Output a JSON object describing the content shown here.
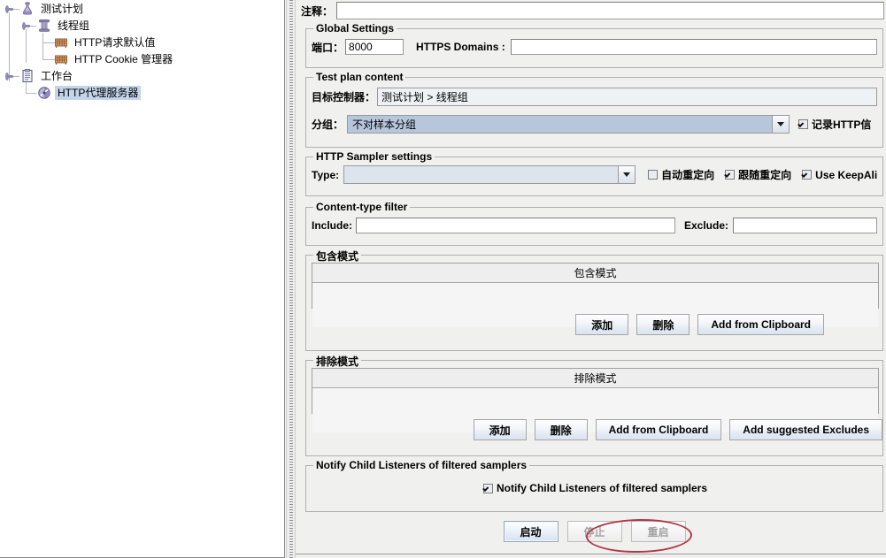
{
  "tree": {
    "nodes": [
      {
        "label": "测试计划",
        "icon": "test-plan-icon",
        "depth": 0,
        "selected": false
      },
      {
        "label": "线程组",
        "icon": "thread-group-icon",
        "depth": 1,
        "selected": false
      },
      {
        "label": "HTTP请求默认值",
        "icon": "http-defaults-icon",
        "depth": 2,
        "selected": false
      },
      {
        "label": "HTTP Cookie 管理器",
        "icon": "http-cookie-manager-icon",
        "depth": 2,
        "selected": false
      },
      {
        "label": "工作台",
        "icon": "workbench-icon",
        "depth": 0,
        "selected": false
      },
      {
        "label": "HTTP代理服务器",
        "icon": "http-proxy-server-icon",
        "depth": 1,
        "selected": true
      }
    ]
  },
  "panel": {
    "comment": {
      "label": "注释：",
      "value": "",
      "placeholder": ""
    },
    "global_settings": {
      "title": "Global Settings",
      "port_label": "端口：",
      "port_value": "8000",
      "https_domains_label": "HTTPS Domains :",
      "https_domains_value": "",
      "placeholder": ""
    },
    "test_plan_content": {
      "title": "Test plan content",
      "target_controller_label": "目标控制器：",
      "target_controller_value": "测试计划 > 线程组",
      "grouping_label": "分组：",
      "grouping_value": "不对样本分组",
      "record_http_label": "记录HTTP信",
      "record_http_checked": true
    },
    "http_sampler_settings": {
      "title": "HTTP Sampler settings",
      "type_label": "Type:",
      "type_value": "",
      "auto_redirect_label": "自动重定向",
      "auto_redirect_checked": false,
      "follow_redirect_label": "跟随重定向",
      "follow_redirect_checked": true,
      "keepalive_label": "Use KeepAli",
      "keepalive_checked": true
    },
    "content_type_filter": {
      "title": "Content-type filter",
      "include_label": "Include:",
      "include_value": "",
      "exclude_label": "Exclude:",
      "exclude_value": ""
    },
    "include_patterns": {
      "title": "包含模式",
      "column_header": "包含模式",
      "rows": [],
      "buttons": [
        {
          "label": "添加",
          "name": "include-add-button"
        },
        {
          "label": "删除",
          "name": "include-delete-button"
        },
        {
          "label": "Add from Clipboard",
          "name": "include-add-from-clipboard-button"
        }
      ]
    },
    "exclude_patterns": {
      "title": "排除模式",
      "column_header": "排除模式",
      "rows": [],
      "buttons": [
        {
          "label": "添加",
          "name": "exclude-add-button"
        },
        {
          "label": "删除",
          "name": "exclude-delete-button"
        },
        {
          "label": "Add from Clipboard",
          "name": "exclude-add-from-clipboard-button"
        },
        {
          "label": "Add suggested Excludes",
          "name": "exclude-add-suggested-button"
        }
      ]
    },
    "notify": {
      "title": "Notify Child Listeners of filtered samplers",
      "checkbox_label": "Notify Child Listeners of filtered samplers",
      "checked": true
    },
    "actions": {
      "start_label": "启动",
      "stop_label": "停止",
      "restart_label": "重启",
      "stop_disabled": true,
      "restart_disabled": true
    }
  },
  "colors": {
    "panel_bg": "#f0f0ee",
    "selection_blue": "#c3d5ea",
    "combo_selected": "#b6c6dc",
    "annotation_red": "#b5354a",
    "border_gray": "#b0b0b0"
  }
}
